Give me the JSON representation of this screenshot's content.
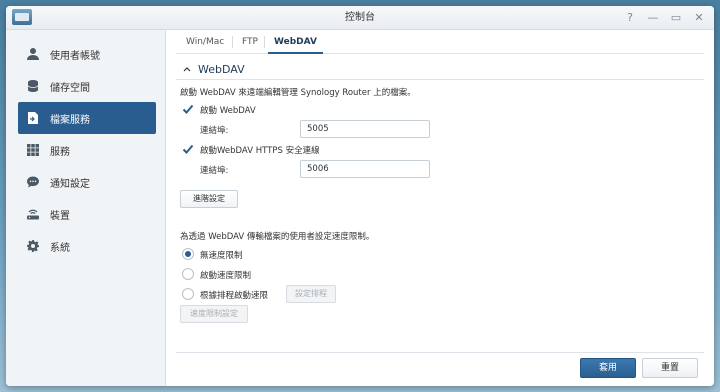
{
  "window": {
    "title": "控制台",
    "controls": [
      "?",
      "—",
      "▭",
      "✕"
    ]
  },
  "sidebar": {
    "items": [
      {
        "label": "使用者帳號",
        "icon": "user-icon",
        "active": false
      },
      {
        "label": "儲存空間",
        "icon": "database-icon",
        "active": false
      },
      {
        "label": "檔案服務",
        "icon": "file-services-icon",
        "active": true
      },
      {
        "label": "服務",
        "icon": "grid-icon",
        "active": false
      },
      {
        "label": "通知設定",
        "icon": "chat-bubble-icon",
        "active": false
      },
      {
        "label": "裝置",
        "icon": "router-icon",
        "active": false
      },
      {
        "label": "系統",
        "icon": "gear-icon",
        "active": false
      }
    ]
  },
  "tabs": [
    {
      "label": "Win/Mac",
      "active": false
    },
    {
      "label": "FTP",
      "active": false
    },
    {
      "label": "WebDAV",
      "active": true
    }
  ],
  "section": {
    "title": "WebDAV",
    "description": "啟動 WebDAV 來遠端編輯管理 Synology Router 上的檔案。",
    "enable_webdav": {
      "label": "啟動 WebDAV",
      "checked": true
    },
    "port_label_1": "連結埠:",
    "port_value_1": "5005",
    "enable_https": {
      "label": "啟動WebDAV HTTPS 安全連線",
      "checked": true
    },
    "port_label_2": "連結埠:",
    "port_value_2": "5006",
    "advanced_button": "進階設定",
    "speed_description": "為透過 WebDAV 傳輸檔案的使用者設定速度限制。",
    "speed_options": [
      {
        "label": "無速度限制",
        "selected": true
      },
      {
        "label": "啟動速度限制",
        "selected": false
      },
      {
        "label": "根據排程啟動速限",
        "selected": false
      }
    ],
    "schedule_button": "設定排程",
    "speed_settings_button": "速度限制設定"
  },
  "footer": {
    "apply_label": "套用",
    "reset_label": "重置"
  },
  "colors": {
    "accent": "#2a5d8f",
    "check": "#2a5d8f"
  }
}
